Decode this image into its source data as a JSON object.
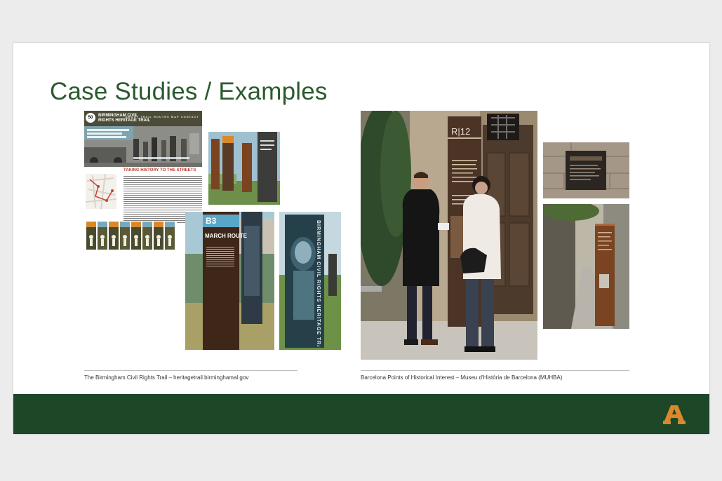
{
  "slide": {
    "title": "Case Studies / Examples"
  },
  "birmingham": {
    "caption": "The Birmingham Civil Rights Trail – heritagetrail.birminghamal.gov",
    "website": {
      "badge": "50",
      "site_title": "BIRMINGHAM CIVIL RIGHTS HERITAGE TRAIL",
      "nav": "ABOUT   TRAIL   ROUTES   MAP   CONTACT",
      "article_heading": "TAKING HISTORY TO THE STREETS"
    },
    "signs": {
      "b3_code": "B3",
      "b3_title": "MARCH ROUTE",
      "vertical_text": "BIRMINGHAM CIVIL RIGHTS HERITAGE TRAIL"
    }
  },
  "barcelona": {
    "caption": "Barcelona Points of Historical Interest – Museu d'Història de Barcelona (MUHBA)",
    "sign_code": "R|12"
  },
  "colors": {
    "title_green": "#2b5a2f",
    "footer_green": "#1d4727",
    "logo_orange": "#d9892b",
    "corten_rust": "#7a4322"
  },
  "icons": {
    "logo": "block-a-logo-icon"
  }
}
